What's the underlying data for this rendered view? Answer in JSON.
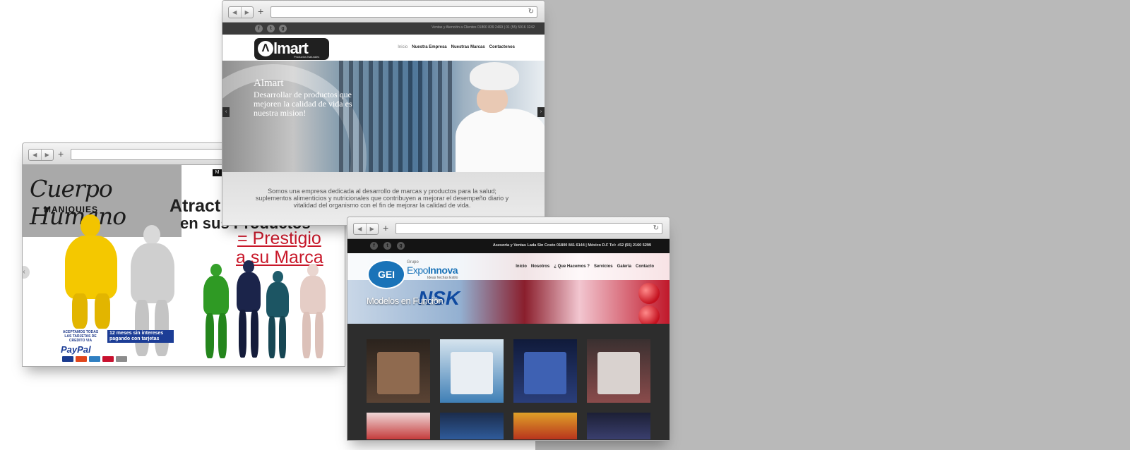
{
  "win1": {
    "logo_script": "Cuerpo Humano",
    "logo_sub": "MANIQUIES",
    "menu_tag": "M",
    "headline1": "Atract",
    "headline2": "en sus Productos",
    "red_line1": "= Prestigio",
    "red_line2": "a su Marca",
    "prev_arrow": "‹",
    "pay_small": "ACEPTAMOS TODAS LAS TARJETAS DE CREDITO VIA",
    "pay_big": "12 meses sin intereses pagando con tarjetas",
    "paypal": "PayPal"
  },
  "win2": {
    "social": [
      "f",
      "t",
      "g"
    ],
    "contact": "Ventas y Atención a Clientes 01800 839 2469 | 01 (55) 5916 3242",
    "logo_mark": "Λ",
    "logo_text": "lmart",
    "logo_sub": "Productos Naturales",
    "nav": [
      "Inicio",
      "Nuestra Empresa",
      "Nuestras Marcas",
      "Contactenos"
    ],
    "hero_title": "Almart",
    "hero_text": "Desarrollar de productos que mejoren la calidad de vida es nuestra mision!",
    "arrow_left": "‹",
    "arrow_right": "›",
    "about": "Somos una empresa dedicada al desarrollo de marcas y productos para la salud; suplementos alimenticios y nutricionales que contribuyen a mejorar el desempeño diario y vitalidad del organismo con el fin de mejorar la calidad de vida."
  },
  "win3": {
    "social": [
      "f",
      "t",
      "g"
    ],
    "contact": "Asesoría y Ventas Lada Sin Costo 01800 841 6144 | México D.F Tel: +52 (55) 2160 5299",
    "logo_mark": "GEI",
    "logo_grupo": "Grupo",
    "logo_expo": "Expo",
    "logo_innova": "Innova",
    "logo_ideas": "Ideas hechas Estilo",
    "nav": [
      "Inicio",
      "Nosotros",
      "¿ Que Hacemos ?",
      "Servicios",
      "Galeria",
      "Contacto"
    ],
    "hero_brand": "NSK",
    "hero_title": "Modelos en Función",
    "thumb_colors": [
      "#5a4334",
      "#3f7fb6",
      "#2a3e7a",
      "#8a4b4b",
      "#c43b3b",
      "#2f5b9a",
      "#b8341d",
      "#3a3f6e"
    ]
  },
  "icons": {
    "back": "◀",
    "forward": "▶",
    "new_tab": "+",
    "reload": "↻"
  }
}
